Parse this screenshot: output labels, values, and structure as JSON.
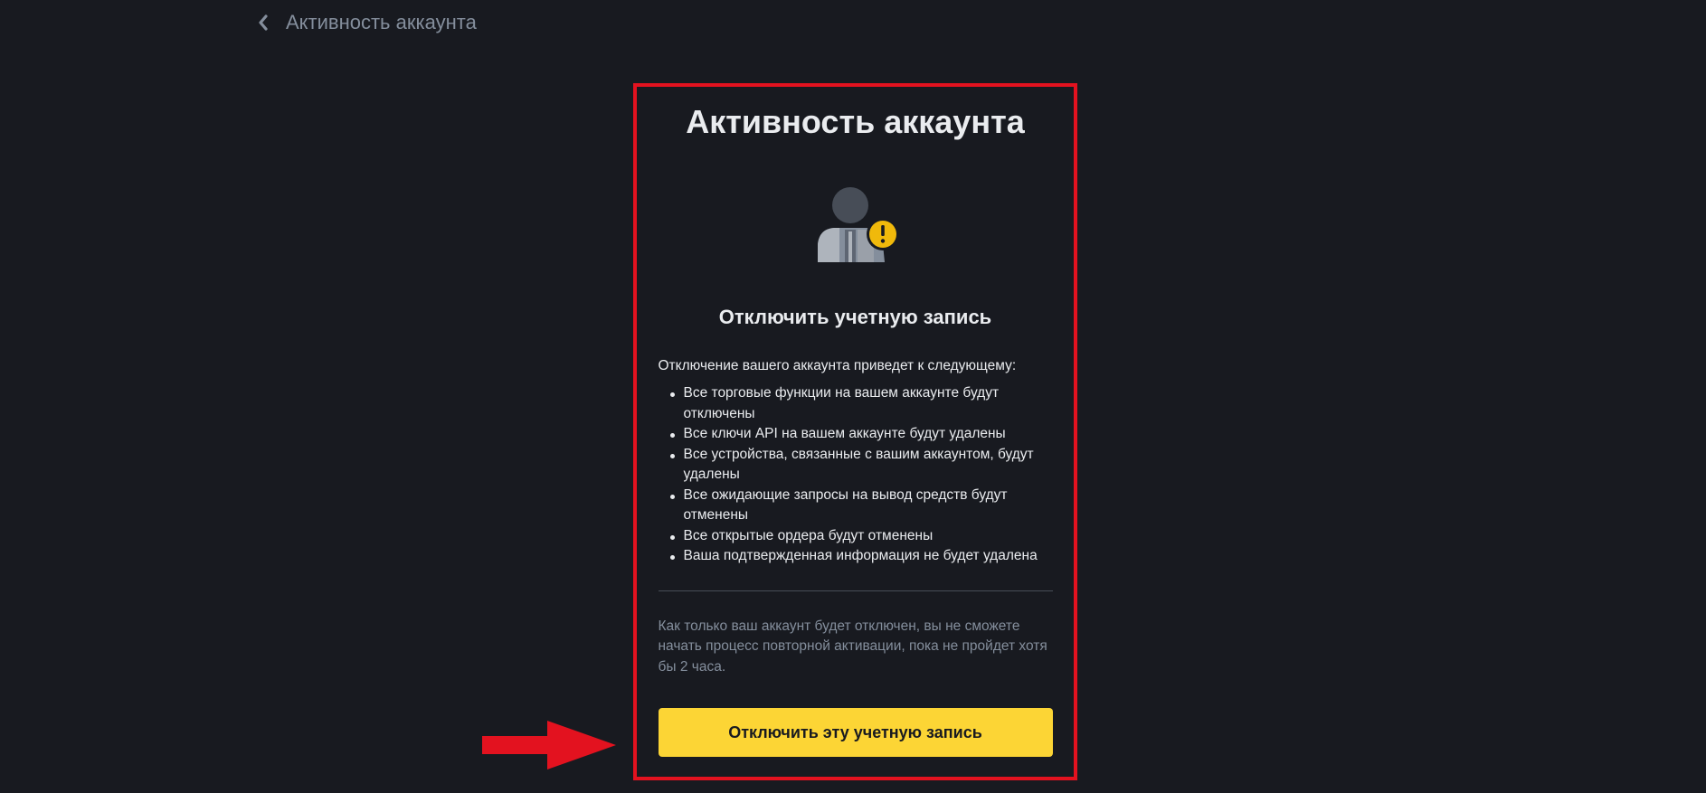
{
  "header": {
    "back_icon": "chevron-left-icon",
    "title": "Активность аккаунта"
  },
  "card": {
    "title": "Активность аккаунта",
    "illustration_icon": "user-warning-icon",
    "subtitle": "Отключить учетную запись",
    "intro": "Отключение вашего аккаунта приведет к следующему:",
    "consequences": [
      "Все торговые функции на вашем аккаунте будут отключены",
      "Все ключи API на вашем аккаунте будут удалены",
      "Все устройства, связанные с вашим аккаунтом, будут удалены",
      "Все ожидающие запросы на вывод средств будут отменены",
      "Все открытые ордера будут отменены",
      "Ваша подтвержденная информация не будет удалена"
    ],
    "note": "Как только ваш аккаунт будет отключен, вы не сможете начать процесс повторной активации, пока не пройдет хотя бы 2 часа.",
    "button_label": "Отключить эту учетную запись"
  },
  "annotation": {
    "frame_color": "#e3121f",
    "arrow_color": "#e3121f",
    "arrow_icon": "arrow-right-icon"
  },
  "colors": {
    "background": "#181a20",
    "accent": "#fcd535",
    "text_primary": "#eaecef",
    "text_secondary": "#848e9c"
  }
}
